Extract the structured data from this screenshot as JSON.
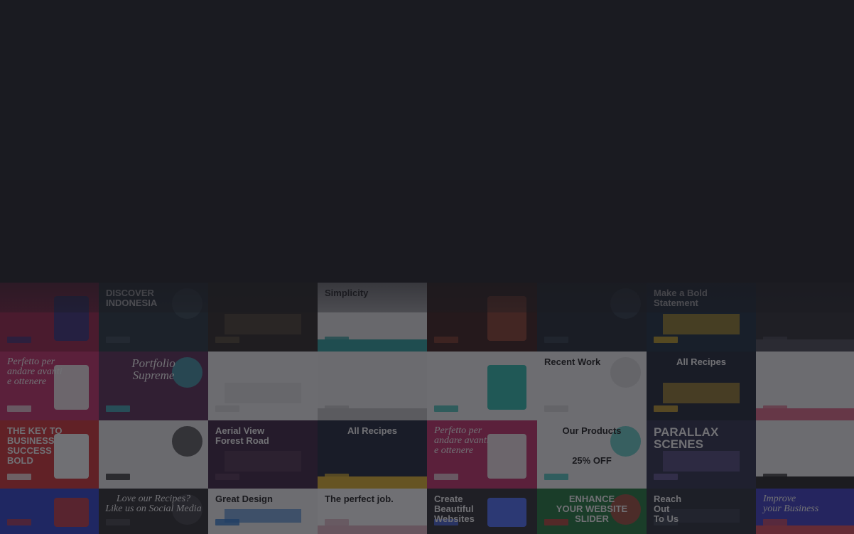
{
  "background": {
    "color": "#1e1f24",
    "overlay": "#18191f"
  },
  "mosaic": {
    "tiles": [
      {
        "bg": "#9b2048",
        "accent": "#3a2d7a",
        "caption": "",
        "style": ""
      },
      {
        "bg": "#24323d",
        "accent": "#3b4b58",
        "caption": "DISCOVER\nINDONESIA",
        "style": ""
      },
      {
        "bg": "#2b2622",
        "accent": "#5a4d3a",
        "caption": "",
        "style": ""
      },
      {
        "bg": "#e9e9e9",
        "accent": "#2aa3a0",
        "caption": "Simplicity",
        "style": "dark"
      },
      {
        "bg": "#3a1b18",
        "accent": "#8a3d2a",
        "caption": "",
        "style": ""
      },
      {
        "bg": "#1d2530",
        "accent": "#33404d",
        "caption": "",
        "style": ""
      },
      {
        "bg": "#1a2a3d",
        "accent": "#e0b520",
        "caption": "Make a Bold\nStatement",
        "style": ""
      },
      {
        "bg": "#2a2a30",
        "accent": "#4a4a55",
        "caption": "",
        "style": ""
      },
      {
        "bg": "#c82d6a",
        "accent": "#f3e4e9",
        "caption": "Perfetto per\nandare avanti\ne ottenere",
        "style": "serif"
      },
      {
        "bg": "#5a2a55",
        "accent": "#38c1c9",
        "caption": "Portfolio\nSupreme",
        "style": "serif center large"
      },
      {
        "bg": "#f5f5f5",
        "accent": "#dcdcdc",
        "caption": "",
        "style": "dark"
      },
      {
        "bg": "#f2f2f2",
        "accent": "#c8c8c8",
        "caption": "",
        "style": "dark"
      },
      {
        "bg": "#f7f7f7",
        "accent": "#2dbfb0",
        "caption": "",
        "style": "dark"
      },
      {
        "bg": "#f7f7f7",
        "accent": "#d8d8d8",
        "caption": "Recent Work",
        "style": "dark"
      },
      {
        "bg": "#1c2233",
        "accent": "#e5b52b",
        "caption": "All Recipes",
        "style": "center"
      },
      {
        "bg": "#f4f4f4",
        "accent": "#e46a8a",
        "caption": "",
        "style": "dark"
      },
      {
        "bg": "#d83033",
        "accent": "#ffffff",
        "caption": "THE KEY TO\nBUSINESS SUCCESS\nBOLD",
        "style": ""
      },
      {
        "bg": "#f0f0f0",
        "accent": "#222222",
        "caption": "",
        "style": "dark"
      },
      {
        "bg": "#3a2140",
        "accent": "#5a3a55",
        "caption": "Aerial View\nForest Road",
        "style": ""
      },
      {
        "bg": "#1b2438",
        "accent": "#e5b52b",
        "caption": "All Recipes",
        "style": "center"
      },
      {
        "bg": "#c82d6a",
        "accent": "#f3e4e9",
        "caption": "Perfetto per\nandare avanti\ne ottenere",
        "style": "serif"
      },
      {
        "bg": "#f7f7f7",
        "accent": "#2fc1b6",
        "caption": "Our Products\n\n\n25% OFF",
        "style": "dark center"
      },
      {
        "bg": "#2a2e4a",
        "accent": "#6a5aa0",
        "caption": "PARALLAX\nSCENES",
        "style": "large"
      },
      {
        "bg": "#f5f5f5",
        "accent": "#222222",
        "caption": "",
        "style": "dark"
      },
      {
        "bg": "#2a3fd0",
        "accent": "#c0374a",
        "caption": "",
        "style": ""
      },
      {
        "bg": "#2a2a2e",
        "accent": "#4a4a50",
        "caption": "Love our Recipes?\nLike us on Social Media",
        "style": "serif center"
      },
      {
        "bg": "#f6f6f6",
        "accent": "#2b7ad6",
        "caption": "Great Design",
        "style": "dark"
      },
      {
        "bg": "#ffffff",
        "accent": "#e6b7c4",
        "caption": "The perfect job.",
        "style": "dark"
      },
      {
        "bg": "#2c2c30",
        "accent": "#4d6fff",
        "caption": "Create\nBeautiful\nWebsites",
        "style": ""
      },
      {
        "bg": "#1d7a3a",
        "accent": "#d93a3a",
        "caption": "ENHANCE\nYOUR WEBSITE\nSLIDER",
        "style": "center"
      },
      {
        "bg": "#252a35",
        "accent": "#3d4555",
        "caption": "Reach\nOut\nTo Us",
        "style": ""
      },
      {
        "bg": "#3b3bc9",
        "accent": "#e04a5a",
        "caption": "Improve\nyour Business",
        "style": "serif"
      }
    ]
  }
}
